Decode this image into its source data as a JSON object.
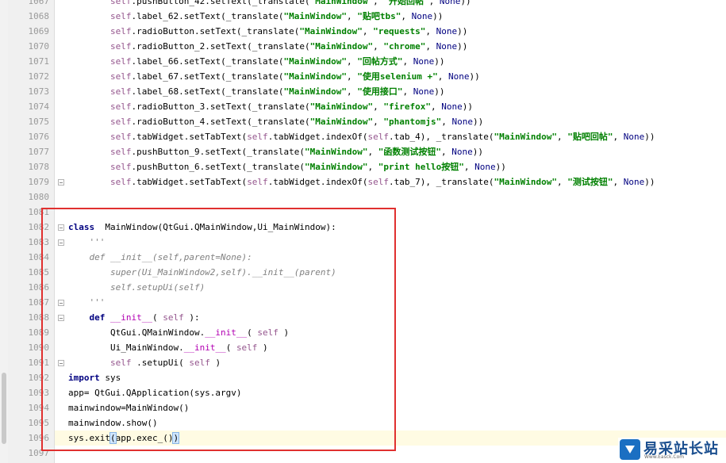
{
  "editor": {
    "lines": [
      {
        "n": "1067",
        "code": "        self.pushButton_42.setText(_translate(\"MainWindow\", \"开始回帖\", None))"
      },
      {
        "n": "1068",
        "code": "        self.label_62.setText(_translate(\"MainWindow\", \"贴吧tbs\", None))"
      },
      {
        "n": "1069",
        "code": "        self.radioButton.setText(_translate(\"MainWindow\", \"requests\", None))"
      },
      {
        "n": "1070",
        "code": "        self.radioButton_2.setText(_translate(\"MainWindow\", \"chrome\", None))"
      },
      {
        "n": "1071",
        "code": "        self.label_66.setText(_translate(\"MainWindow\", \"回帖方式\", None))"
      },
      {
        "n": "1072",
        "code": "        self.label_67.setText(_translate(\"MainWindow\", \"使用selenium +\", None))"
      },
      {
        "n": "1073",
        "code": "        self.label_68.setText(_translate(\"MainWindow\", \"使用接口\", None))"
      },
      {
        "n": "1074",
        "code": "        self.radioButton_3.setText(_translate(\"MainWindow\", \"firefox\", None))"
      },
      {
        "n": "1075",
        "code": "        self.radioButton_4.setText(_translate(\"MainWindow\", \"phantomjs\", None))"
      },
      {
        "n": "1076",
        "code": "        self.tabWidget.setTabText(self.tabWidget.indexOf(self.tab_4), _translate(\"MainWindow\", \"贴吧回帖\", None))"
      },
      {
        "n": "1077",
        "code": "        self.pushButton_9.setText(_translate(\"MainWindow\", \"函数测试按钮\", None))"
      },
      {
        "n": "1078",
        "code": "        self.pushButton_6.setText(_translate(\"MainWindow\", \"print hello按钮\", None))"
      },
      {
        "n": "1079",
        "code": "        self.tabWidget.setTabText(self.tabWidget.indexOf(self.tab_7), _translate(\"MainWindow\", \"测试按钮\", None))"
      },
      {
        "n": "1080",
        "code": ""
      },
      {
        "n": "1081",
        "code": ""
      },
      {
        "n": "1082",
        "code": "class  MainWindow(QtGui.QMainWindow,Ui_MainWindow):"
      },
      {
        "n": "1083",
        "code": "    '''"
      },
      {
        "n": "1084",
        "code": "    def __init__(self,parent=None):"
      },
      {
        "n": "1085",
        "code": "        super(Ui_MainWindow2,self).__init__(parent)"
      },
      {
        "n": "1086",
        "code": "        self.setupUi(self)"
      },
      {
        "n": "1087",
        "code": "    '''"
      },
      {
        "n": "1088",
        "code": "    def __init__( self ):"
      },
      {
        "n": "1089",
        "code": "        QtGui.QMainWindow.__init__( self )"
      },
      {
        "n": "1090",
        "code": "        Ui_MainWindow.__init__( self )"
      },
      {
        "n": "1091",
        "code": "        self .setupUi( self )"
      },
      {
        "n": "1092",
        "code": "import sys"
      },
      {
        "n": "1093",
        "code": "app= QtGui.QApplication(sys.argv)"
      },
      {
        "n": "1094",
        "code": "mainwindow=MainWindow()"
      },
      {
        "n": "1095",
        "code": "mainwindow.show()"
      },
      {
        "n": "1096",
        "code": "sys.exit(app.exec_())"
      },
      {
        "n": "1097",
        "code": ""
      }
    ],
    "current_line": "1096",
    "fold_lines": [
      "1079",
      "1082",
      "1083",
      "1087",
      "1088",
      "1091"
    ]
  },
  "watermark": {
    "text": "易采站长站",
    "sub": "Www.Easck.Com"
  },
  "colors": {
    "keyword": "#000080",
    "self": "#94558d",
    "string": "#008000",
    "selection_box": "#e0302f"
  }
}
